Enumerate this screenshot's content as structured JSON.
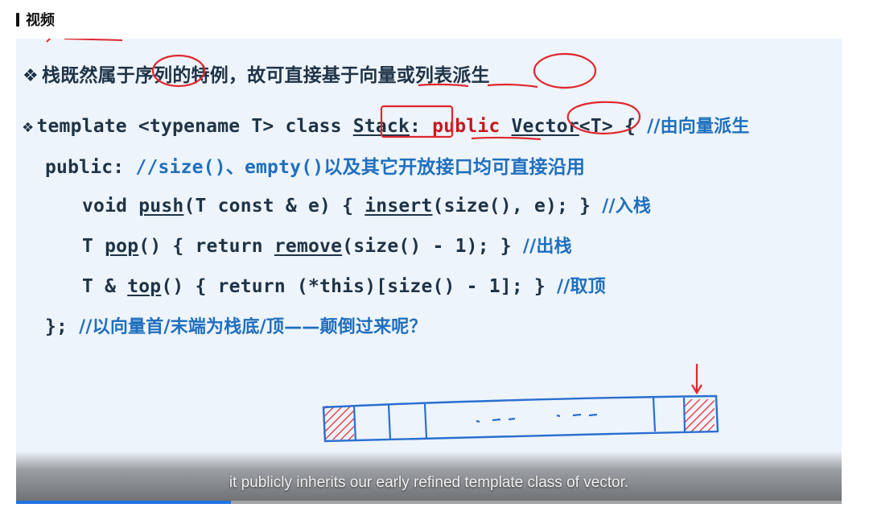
{
  "section": {
    "title": "视频"
  },
  "slide": {
    "bullet": "❖",
    "line1": {
      "text": "栈既然属于序列的特例，故可直接基于向量或列表派生"
    },
    "line2": {
      "t1": "template <typename T> class ",
      "t2": "Stack",
      "t3": ": ",
      "t4": "public",
      "t5": " ",
      "t6": "Vector",
      "t7": "<T> { ",
      "t8": "//由向量派生"
    },
    "line3": {
      "t1": "public: ",
      "t2": "//size()、empty()以及其它开放接口均可直接沿用"
    },
    "line4": {
      "t1": "void ",
      "t2": "push",
      "t3": "(T const & e) { ",
      "t4": "insert",
      "t5": "(size(), e); }  ",
      "t6": "//入栈"
    },
    "line5": {
      "t1": "T ",
      "t2": "pop",
      "t3": "() { return ",
      "t4": "remove",
      "t5": "(size() - 1); } ",
      "t6": "//出栈"
    },
    "line6": {
      "t1": "T & ",
      "t2": "top",
      "t3": "() { return (*this)[size() - 1]; } ",
      "t4": "//取顶"
    },
    "line7": {
      "t1": "}; ",
      "t2": "//以向量首/末端为栈底/顶——颠倒过来呢？"
    }
  },
  "video": {
    "subtitle": "it publicly inherits our early refined template class of vector.",
    "progress": 0.26
  },
  "colors": {
    "code_dark": "#1f3347",
    "comment_blue": "#1f6fbf",
    "keyword_red": "#c8161d",
    "annotation_red": "#e0272e",
    "drawing_blue": "#2a6fd1",
    "progress_blue": "#1f74e6"
  }
}
